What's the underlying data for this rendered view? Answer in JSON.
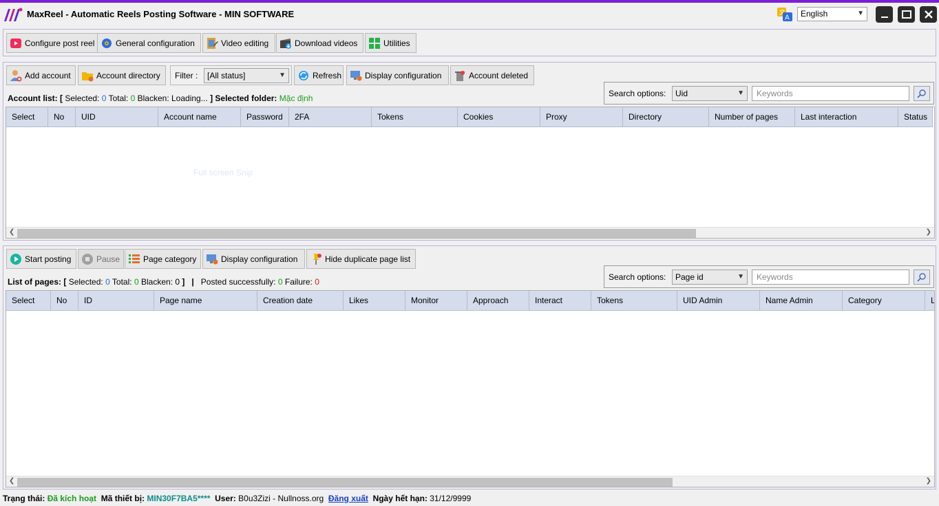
{
  "window": {
    "title": "MaxReel - Automatic Reels Posting Software - MIN SOFTWARE",
    "language": "English",
    "accent": "#7c1ed6"
  },
  "main_toolbar": [
    {
      "label": "Configure post reel",
      "icon": "reel-icon"
    },
    {
      "label": "General configuration",
      "icon": "gear-icon"
    },
    {
      "label": "Video editing",
      "icon": "film-edit-icon"
    },
    {
      "label": "Download videos",
      "icon": "download-video-icon"
    },
    {
      "label": "Utilities",
      "icon": "grid-apps-icon"
    }
  ],
  "account_toolbar": {
    "add_account": "Add account",
    "account_directory": "Account directory",
    "filter_label": "Filter :",
    "filter_value": "[All status]",
    "refresh": "Refresh",
    "display_configuration": "Display configuration",
    "account_deleted": "Account deleted"
  },
  "account_info": {
    "label": "Account list:",
    "open_bracket": "[",
    "selected_label": "Selected:",
    "selected": "0",
    "total_label": "Total:",
    "total": "0",
    "blacken_label": "Blacken:",
    "blacken": "Loading...",
    "close_bracket": "]",
    "folder_label": "Selected folder:",
    "folder": "Mặc định"
  },
  "account_search": {
    "label": "Search options:",
    "option": "Uid",
    "placeholder": "Keywords"
  },
  "account_columns": [
    "Select",
    "No",
    "UID",
    "Account name",
    "Password",
    "2FA",
    "Tokens",
    "Cookies",
    "Proxy",
    "Directory",
    "Number of pages",
    "Last interaction",
    "Status"
  ],
  "account_ghost": "Full screen Snip",
  "page_toolbar": {
    "start_posting": "Start posting",
    "pause": "Pause",
    "page_category": "Page category",
    "display_configuration": "Display configuration",
    "hide_duplicate": "Hide duplicate page list"
  },
  "page_info": {
    "label": "List of pages:",
    "open_bracket": "[",
    "selected_label": "Selected:",
    "selected": "0",
    "total_label": "Total:",
    "total": "0",
    "blacken_label": "Blacken:",
    "blacken": "0",
    "close_bracket": "]",
    "separator": "|",
    "success_label": "Posted successfully:",
    "success": "0",
    "failure_label": "Failure:",
    "failure": "0"
  },
  "page_search": {
    "label": "Search options:",
    "option": "Page id",
    "placeholder": "Keywords"
  },
  "page_columns": [
    "Select",
    "No",
    "ID",
    "Page name",
    "Creation date",
    "Likes",
    "Monitor",
    "Approach",
    "Interact",
    "Tokens",
    "UID Admin",
    "Name Admin",
    "Category",
    "L"
  ],
  "status_bar": {
    "status_label": "Trạng thái:",
    "status": "Đã kích hoạt",
    "device_label": "Mã thiết bị:",
    "device": "MIN30F7BA5****",
    "user_label": "User:",
    "user": "B0u3Zizi - Nullnoss.org",
    "logout": "Đăng xuất",
    "expiry_label": "Ngày hết hạn:",
    "expiry": "31/12/9999"
  }
}
